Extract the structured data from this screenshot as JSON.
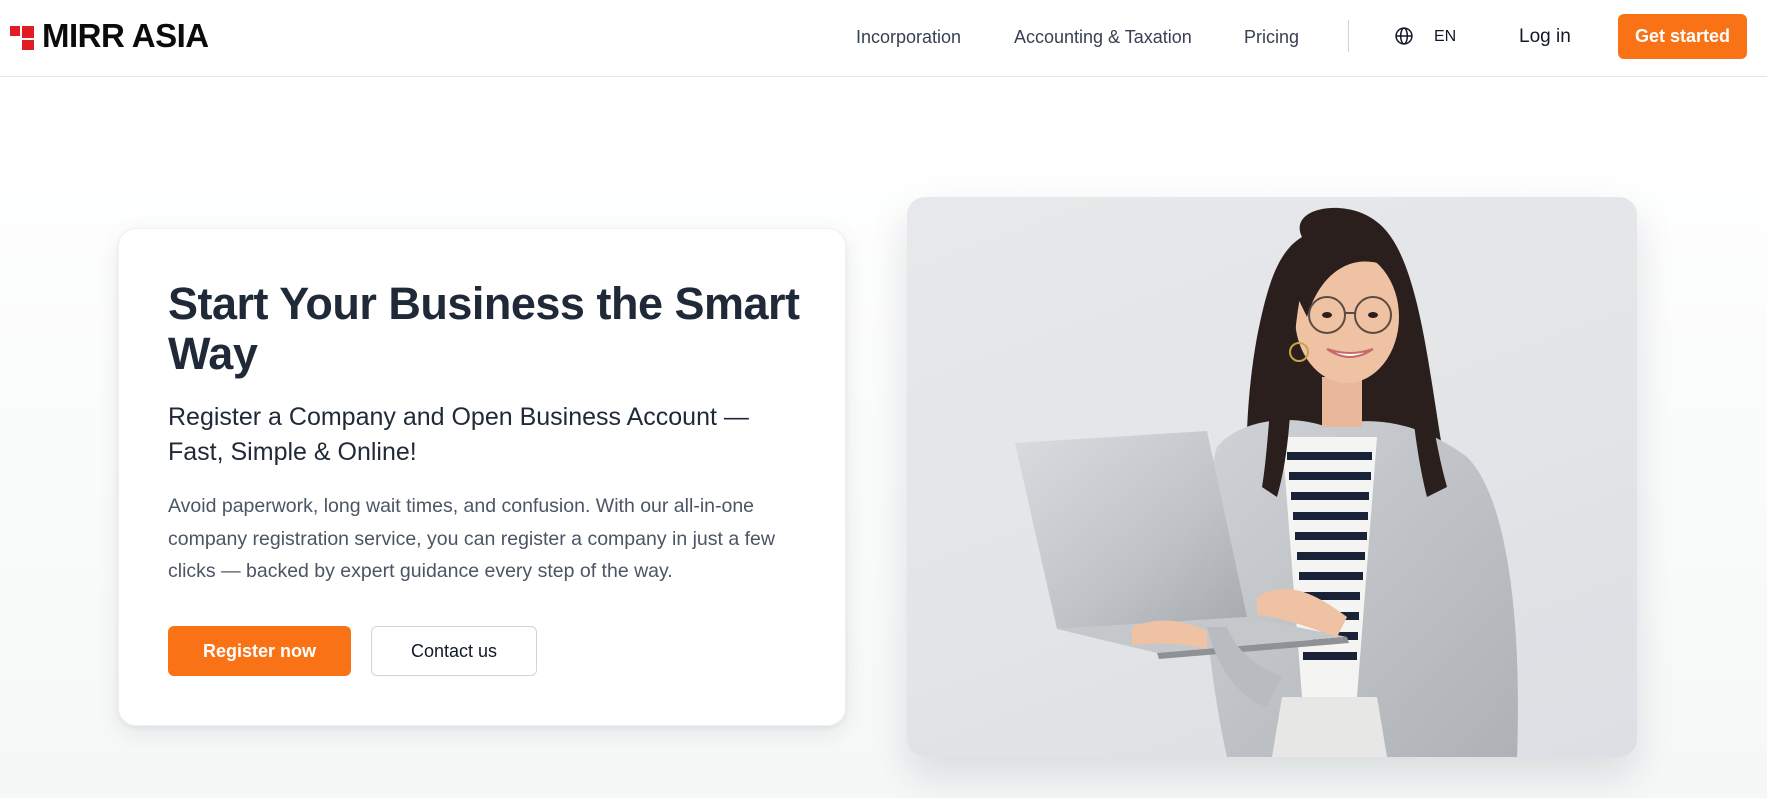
{
  "brand": {
    "name": "MIRR ASIA"
  },
  "nav": {
    "links": [
      "Incorporation",
      "Accounting & Taxation",
      "Pricing"
    ],
    "language": "EN",
    "login": "Log in",
    "cta": "Get started"
  },
  "hero": {
    "title": "Start Your Business the Smart Way",
    "subtitle": "Register a Company and Open Business Account — Fast, Simple & Online!",
    "body": "Avoid paperwork, long wait times, and confusion. With our all-in-one company registration service, you can register a company in just a few clicks — backed by expert guidance every step of the way.",
    "primary_button": "Register now",
    "secondary_button": "Contact us"
  },
  "colors": {
    "accent": "#f97316",
    "brand_red": "#e31b23"
  },
  "icons": {
    "language": "globe-icon"
  }
}
